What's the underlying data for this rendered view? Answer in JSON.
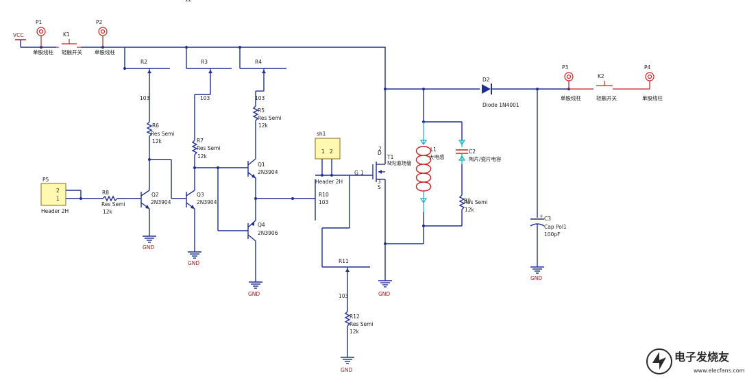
{
  "labels": {
    "vcc": "VCC",
    "p1": "P1",
    "p1_val": "单股线柱",
    "k1": "K1",
    "k1_val": "轻触开关",
    "p2": "P2",
    "p2_val": "单股线柱",
    "p3": "P3",
    "p3_val": "单股线柱",
    "k2": "K2",
    "k2_val": "轻触开关",
    "p4": "P4",
    "p4_val": "单股线柱",
    "p5": "P5",
    "p5_val": "Header 2H",
    "p5_pin2": "2",
    "p5_pin1": "1",
    "r2": "R2",
    "r2_val": "103",
    "r3": "R3",
    "r3_val": "103",
    "r4": "R4",
    "r4_val": "103",
    "r5": "R5",
    "r5_type": "Res Semi",
    "r5_val": "12k",
    "r6": "R6",
    "r6_type": "Res Semi",
    "r6_val": "12k",
    "r7": "R7",
    "r7_type": "Res Semi",
    "r7_val": "12k",
    "r8": "R8",
    "r8_type": "Res Semi",
    "r8_val": "12k",
    "r9": "R9",
    "r9_type": "Res Semi",
    "r9_val": "12k",
    "r10": "R10",
    "r10_val": "103",
    "r11": "R11",
    "r11_val": "103",
    "r12": "R12",
    "r12_type": "Res Semi",
    "r12_val": "12k",
    "q1": "Q1",
    "q1_val": "2N3904",
    "q2": "Q2",
    "q2_val": "2N3904",
    "q3": "Q3",
    "q3_val": "2N3904",
    "q4": "Q4",
    "q4_val": "2N3906",
    "hdr1": "sh1",
    "hdr1_val": "Header 2H",
    "hdr1_pin1": "1",
    "hdr1_pin2": "2",
    "t1": "T1",
    "t1_val": "N沟道场管",
    "t1_d": "D",
    "t1_s": "S",
    "t1_g": "G",
    "t1_2": "2",
    "t1_3": "3",
    "t1_1": "1",
    "d2": "D2",
    "d2_val": "Diode 1N4001",
    "l1": "L1",
    "l1_val": "大电感",
    "c2": "C2",
    "c2_val": "陶片/瓷片电容",
    "c3": "C3",
    "c3_type": "Cap Pol1",
    "c3_val": "100pF",
    "gnd": "GND",
    "top_frag": "12"
  },
  "watermark": {
    "title": "电子发烧友",
    "url": "www.elecfans.com"
  },
  "colors": {
    "wire": "#1f2f8f",
    "label": "#1a1a1a",
    "gnd": "#8b1a1a",
    "connector": "#c81e1e",
    "header_fill": "#fff8b0"
  }
}
